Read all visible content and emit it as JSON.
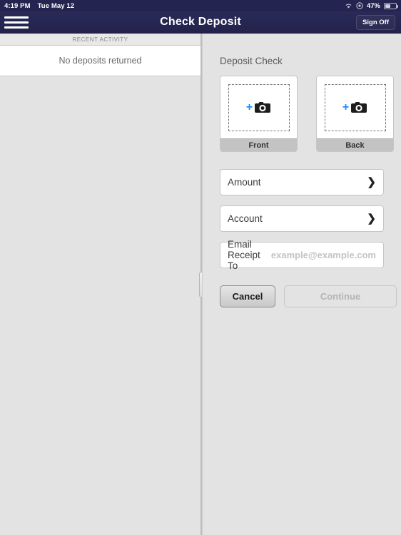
{
  "status_bar": {
    "time": "4:19 PM",
    "date": "Tue May 12",
    "battery_percent": "47%",
    "wifi_icon": "wifi-icon",
    "rotation_lock_icon": "rotation-lock-icon",
    "battery_icon": "battery-icon"
  },
  "nav": {
    "menu_icon": "hamburger-menu-icon",
    "title": "Check Deposit",
    "sign_off_label": "Sign Off"
  },
  "left_pane": {
    "section_header": "RECENT ACTIVITY",
    "empty_message": "No deposits returned"
  },
  "divider": {
    "handle_icon": "drag-handle-icon"
  },
  "right_pane": {
    "section_title": "Deposit Check",
    "captures": [
      {
        "label": "Front",
        "plus_icon": "plus-icon",
        "camera_icon": "camera-icon"
      },
      {
        "label": "Back",
        "plus_icon": "plus-icon",
        "camera_icon": "camera-icon"
      }
    ],
    "fields": [
      {
        "label": "Amount",
        "value": "",
        "chevron_icon": "chevron-right-icon"
      },
      {
        "label": "Account",
        "value": "",
        "chevron_icon": "chevron-right-icon"
      }
    ],
    "email_field": {
      "label": "Email Receipt To",
      "value": "",
      "placeholder": "example@example.com"
    },
    "buttons": {
      "cancel_label": "Cancel",
      "continue_label": "Continue",
      "continue_enabled": false
    }
  },
  "colors": {
    "nav_bar": "#22224c",
    "status_bar": "#242450",
    "page_background": "#e3e3e3",
    "accent_blue": "#1a8cff",
    "panel_white": "#ffffff",
    "capture_label_gray": "#c3c3c3"
  }
}
